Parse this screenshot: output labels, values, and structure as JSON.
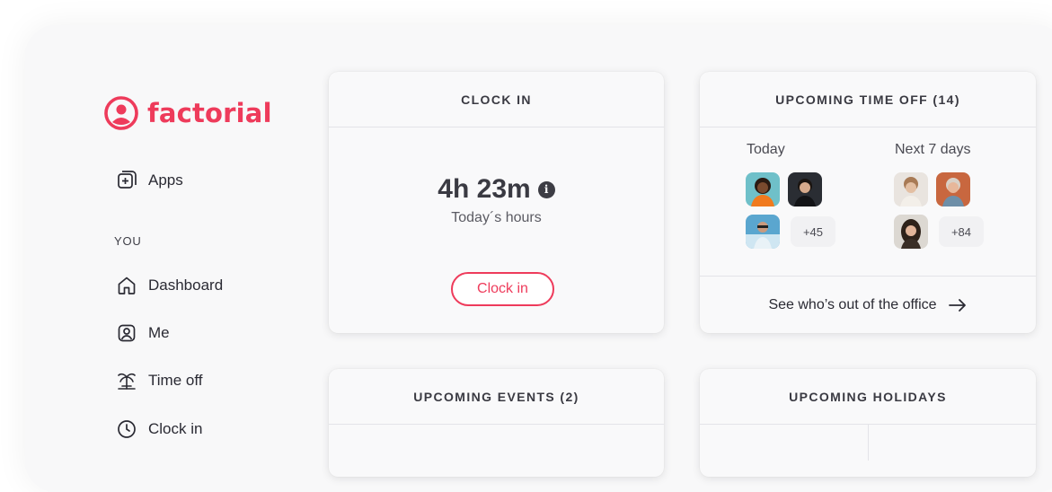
{
  "brand": {
    "name": "factorial",
    "color": "#ee3b5b"
  },
  "sidebar": {
    "apps_label": "Apps",
    "section_label": "YOU",
    "items": [
      {
        "label": "Dashboard",
        "icon": "home-icon"
      },
      {
        "label": "Me",
        "icon": "user-icon"
      },
      {
        "label": "Time off",
        "icon": "palm-tree-icon"
      },
      {
        "label": "Clock in",
        "icon": "clock-icon"
      }
    ]
  },
  "cards": {
    "clock_in": {
      "title": "CLOCK IN",
      "hours": "4h 23m",
      "info": "i",
      "subtitle": "Today´s hours",
      "button": "Clock in"
    },
    "time_off": {
      "title": "UPCOMING TIME OFF (14)",
      "today_label": "Today",
      "next_label": "Next 7 days",
      "today_more": "+45",
      "next_more": "+84",
      "link": "See who’s out of the office"
    },
    "events": {
      "title": "UPCOMING EVENTS (2)"
    },
    "holidays": {
      "title": "UPCOMING HOLIDAYS"
    }
  }
}
